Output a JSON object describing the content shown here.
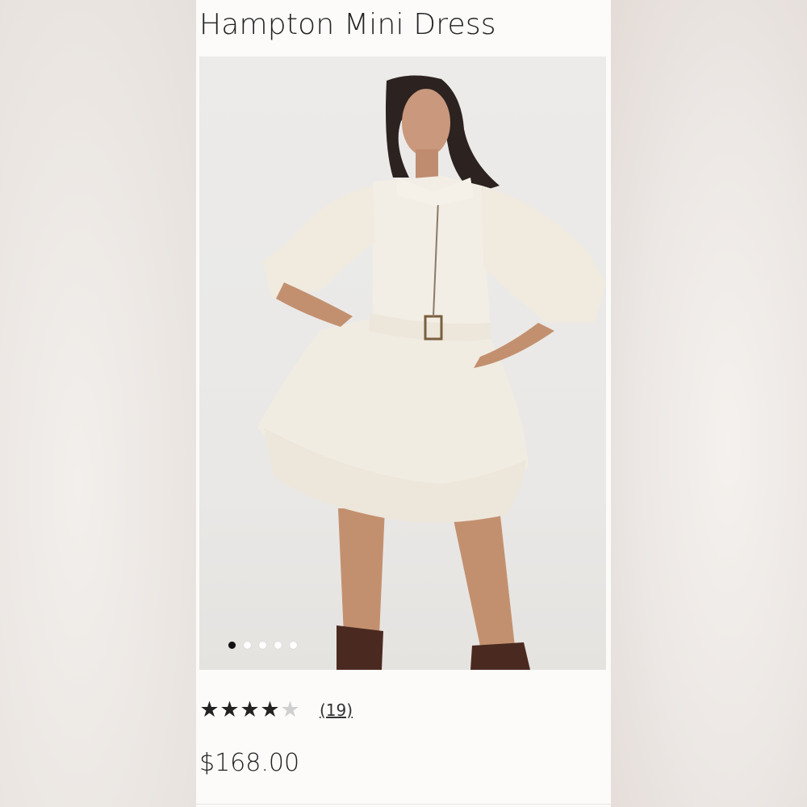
{
  "product": {
    "title": "Hampton Mini Dress",
    "price": "$168.00",
    "rating": {
      "value": 4,
      "max": 5,
      "review_count": "(19)"
    },
    "carousel": {
      "slide_count": 5,
      "active_index": 0
    }
  },
  "icons": {
    "star_filled": "★",
    "star_empty": "★"
  },
  "colors": {
    "background": "#fcfbfa",
    "text": "#222222",
    "star": "#222222",
    "star_empty": "#cfcfcf",
    "dress": "#f1ece2"
  }
}
